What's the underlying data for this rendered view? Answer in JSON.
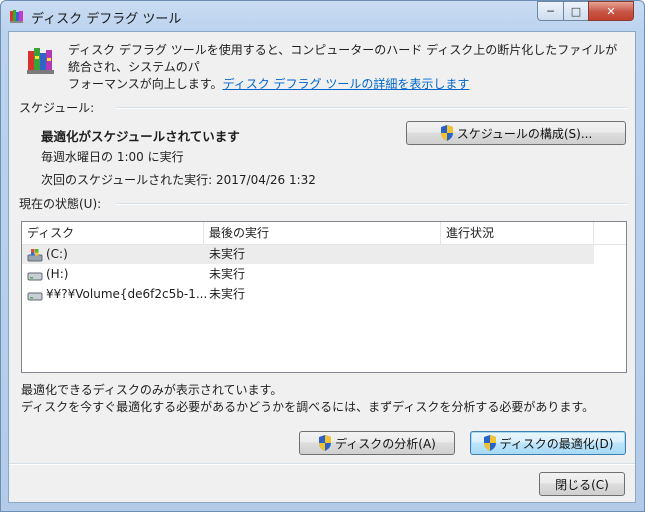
{
  "window": {
    "title": "ディスク デフラグ ツール"
  },
  "title_controls": {
    "minimize": "─",
    "maximize": "□",
    "close": "✕"
  },
  "description": {
    "line1": "ディスク デフラグ ツールを使用すると、コンピューターのハード ディスク上の断片化したファイルが統合され、システムのパ",
    "line2": "フォーマンスが向上します。",
    "link": "ディスク デフラグ ツールの詳細を表示します"
  },
  "schedule": {
    "section_label": "スケジュール:",
    "status": "最適化がスケジュールされています",
    "frequency": "毎週水曜日の 1:00 に実行",
    "next_run": "次回のスケジュールされた実行: 2017/04/26 1:32",
    "configure_button": "スケジュールの構成(S)..."
  },
  "current_status": {
    "section_label": "現在の状態(U):",
    "columns": [
      "ディスク",
      "最後の実行",
      "進行状況"
    ],
    "rows": [
      {
        "disk": "(C:)",
        "last_run": "未実行",
        "progress": "",
        "icon": "system-drive-icon"
      },
      {
        "disk": "(H:)",
        "last_run": "未実行",
        "progress": "",
        "icon": "drive-icon"
      },
      {
        "disk": "¥¥?¥Volume{de6f2c5b-1...",
        "last_run": "未実行",
        "progress": "",
        "icon": "drive-icon"
      }
    ]
  },
  "footer": {
    "note1": "最適化できるディスクのみが表示されています。",
    "note2": "ディスクを今すぐ最適化する必要があるかどうかを調べるには、まずディスクを分析する必要があります。",
    "analyze_button": "ディスクの分析(A)",
    "defrag_button": "ディスクの最適化(D)",
    "close_button": "閉じる(C)"
  },
  "colors": {
    "link": "#0066cc",
    "title_bar": "#bcd3ee",
    "close_button": "#c75444",
    "selected_row": "#ececec"
  }
}
